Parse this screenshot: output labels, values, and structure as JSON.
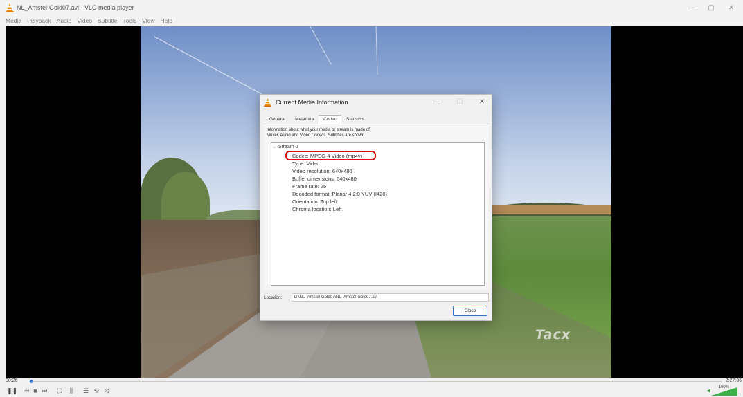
{
  "window": {
    "title": "NL_Amstel-Gold07.avi - VLC media player",
    "controls": {
      "minimize": "—",
      "maximize": "▢",
      "close": "✕"
    }
  },
  "menu": [
    "Media",
    "Playback",
    "Audio",
    "Video",
    "Subtitle",
    "Tools",
    "View",
    "Help"
  ],
  "video": {
    "watermark": "Tacx"
  },
  "dialog": {
    "title": "Current Media Information",
    "controls": {
      "minimize": "—",
      "maximize": "☐",
      "close": "✕"
    },
    "tabs": [
      "General",
      "Metadata",
      "Codec",
      "Statistics"
    ],
    "active_tab": "Codec",
    "info_line1": "Information about what your media or stream is made of.",
    "info_line2": "Muxer, Audio and Video Codecs, Subtitles are shown.",
    "stream_label": "Stream 0",
    "stream_items": [
      "Codec: MPEG-4 Video (mp4v)",
      "Type: Video",
      "Video resolution: 640x480",
      "Buffer dimensions: 640x480",
      "Frame rate: 25",
      "Decoded format: Planar 4:2:0 YUV (I420)",
      "Orientation: Top left",
      "Chroma location: Left"
    ],
    "location_label": "Location:",
    "location_value": "D:\\NL_Amstel-Gold07\\NL_Amstel-Gold07.avi",
    "close_label": "Close"
  },
  "player": {
    "time_elapsed": "00:26",
    "time_total": "2:27:36",
    "seek_fraction": 0.003,
    "volume": "100%",
    "accent_color": "#3a78d4"
  }
}
